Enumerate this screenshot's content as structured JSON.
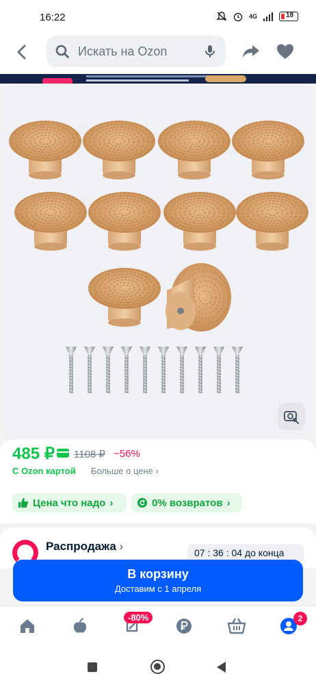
{
  "status_bar": {
    "time": "16:22",
    "network": "4G",
    "battery": "18"
  },
  "header": {
    "search_placeholder": "Искать на Ozon"
  },
  "product": {
    "price": "485 ₽",
    "old_price": "1108 ₽",
    "discount": "−56%",
    "ozon_card_label": "С Ozon картой",
    "more_price_label": "Больше о цене",
    "chips": [
      {
        "label": "Цена что надо"
      },
      {
        "label": "0% возвратов"
      }
    ]
  },
  "sale": {
    "title": "Распродажа",
    "timer": "07 : 36 : 04 до конца"
  },
  "cart": {
    "label": "В корзину",
    "sublabel": "Доставим с 1 апреля"
  },
  "bottom_nav": {
    "items": [
      "home-icon",
      "fresh-icon",
      "promo-icon",
      "finance-icon",
      "cart-icon",
      "profile-icon"
    ],
    "promo_badge": "-80%",
    "profile_badge": "2"
  },
  "colors": {
    "accent": "#005bff",
    "price": "#10c44c",
    "discount": "#f91155"
  }
}
